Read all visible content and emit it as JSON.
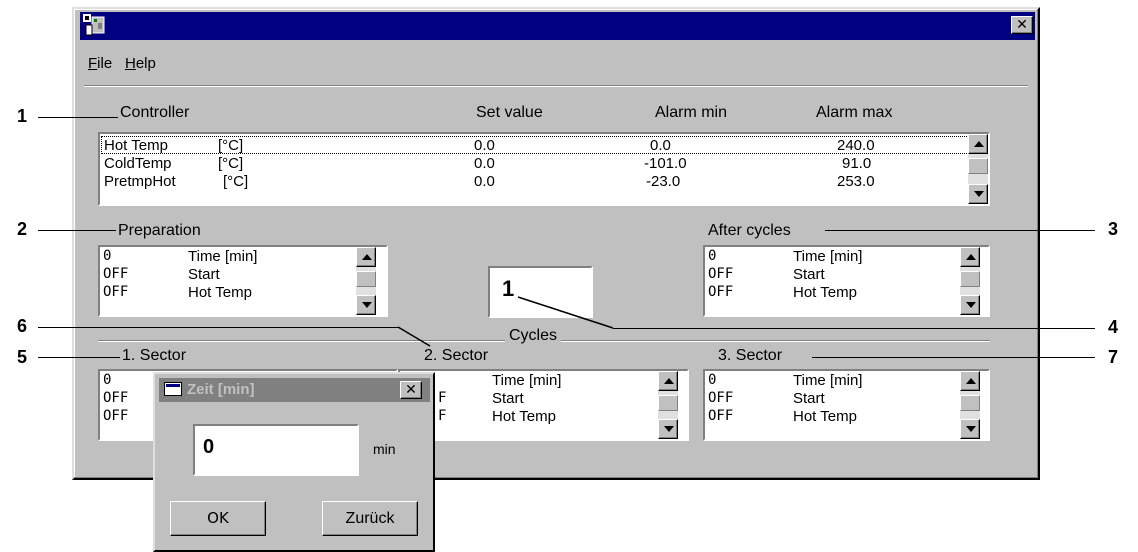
{
  "menu": {
    "file": "File",
    "file_key": "F",
    "file_rest": "ile",
    "help": "Help",
    "help_key": "H",
    "help_rest": "elp"
  },
  "headers": {
    "controller": "Controller",
    "set_value": "Set value",
    "alarm_min": "Alarm min",
    "alarm_max": "Alarm max"
  },
  "controller_rows": [
    {
      "name": "Hot Temp",
      "unit": "[°C]",
      "set": "0.0",
      "min": "0.0",
      "max": "240.0"
    },
    {
      "name": "ColdTemp",
      "unit": "[°C]",
      "set": "0.0",
      "min": "-101.0",
      "max": "91.0"
    },
    {
      "name": "PretmpHot",
      "unit": "[°C]",
      "set": "0.0",
      "min": "-23.0",
      "max": "253.0"
    }
  ],
  "groups": {
    "preparation": "Preparation",
    "after_cycles": "After cycles",
    "cycles": "Cycles",
    "sector1": "1. Sector",
    "sector2": "2. Sector",
    "sector3": "3. Sector"
  },
  "step_rows": [
    {
      "value": "0",
      "label": "Time [min]"
    },
    {
      "value": "OFF",
      "label": "Start"
    },
    {
      "value": "OFF",
      "label": "Hot Temp"
    }
  ],
  "sector2_rows": [
    {
      "value": "F",
      "label": "Start"
    },
    {
      "value": "F",
      "label": "Hot Temp"
    }
  ],
  "cycles_value": "1",
  "callouts": [
    "1",
    "2",
    "3",
    "4",
    "5",
    "6",
    "7"
  ],
  "dialog": {
    "title": "Zeit [min]",
    "value": "0",
    "unit": "min",
    "ok": "OK",
    "back": "Zurück"
  },
  "colors": {
    "titlebar": "#000080",
    "dialog_titlebar": "#808080",
    "face": "#c0c0c0"
  }
}
